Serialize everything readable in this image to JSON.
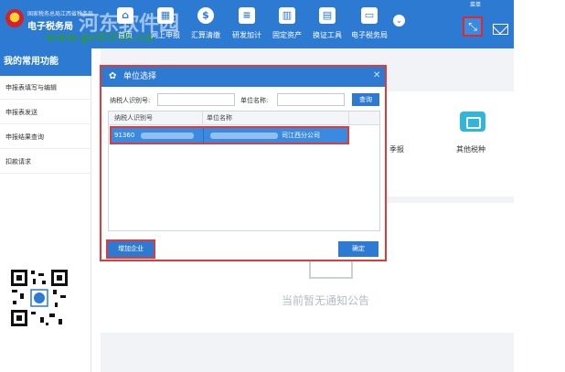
{
  "header": {
    "brand_line1": "国家税务总局江西省税务局",
    "brand_line2": "电子税务局",
    "watermark_text": "www.pc0359.cn",
    "watermark_mark": "河东软件园",
    "user_menu_label": "菜单",
    "nav": [
      {
        "label": "首页",
        "icon": "home-icon",
        "glyph": "⌂"
      },
      {
        "label": "网上申报",
        "icon": "calendar-icon",
        "glyph": "▦"
      },
      {
        "label": "汇算清缴",
        "icon": "dollar-icon",
        "glyph": "$"
      },
      {
        "label": "研发加计",
        "icon": "stack-icon",
        "glyph": "≡"
      },
      {
        "label": "固定资产",
        "icon": "building-icon",
        "glyph": "▥"
      },
      {
        "label": "换证工具",
        "icon": "cards-icon",
        "glyph": "▤"
      },
      {
        "label": "电子税务局",
        "icon": "monitor-icon",
        "glyph": "▭"
      }
    ]
  },
  "sidebar": {
    "title": "我的常用功能",
    "items": [
      "申报表填写与编辑",
      "申报表发送",
      "申报结果查询",
      "扣款请求"
    ]
  },
  "main": {
    "tiles": [
      "季报",
      "其他税种"
    ],
    "empty_notice": "当前暂无通知公告"
  },
  "modal": {
    "title": "单位选择",
    "taxpayer_id_label": "纳税人识别号:",
    "taxpayer_id_value": "",
    "unit_name_label": "单位名称:",
    "unit_name_value": "",
    "query_button": "查询",
    "columns": [
      "纳税人识别号",
      "单位名称"
    ],
    "rows": [
      {
        "taxpayer_id": "91360",
        "unit_name": "司江西分公司"
      }
    ],
    "add_button": "增加企业",
    "confirm_button": "确定"
  },
  "colors": {
    "primary": "#2d7ad2",
    "highlight_border": "#e03a3a",
    "selected_row": "#3a8ae0",
    "other_tax_icon": "#2fb6d9"
  }
}
